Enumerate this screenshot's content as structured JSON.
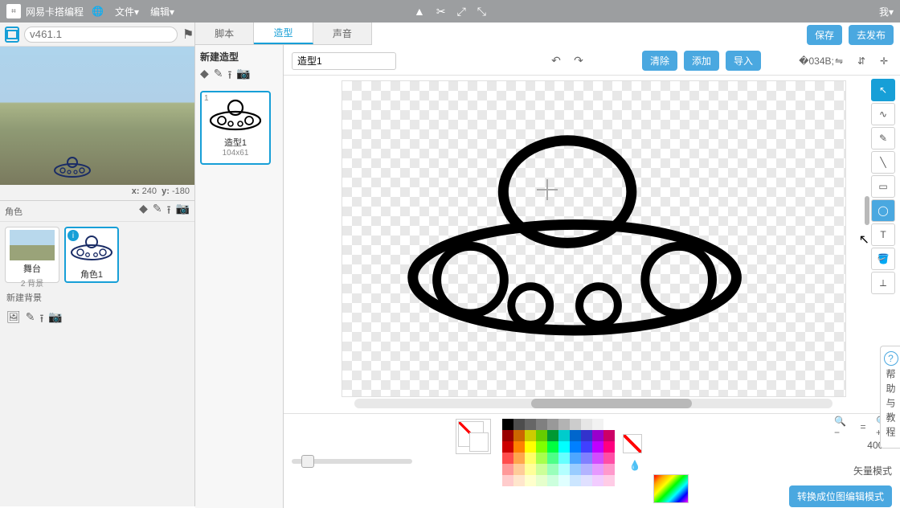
{
  "topbar": {
    "brand": "网易卡搭编程",
    "menus": [
      "文件▾",
      "编辑▾"
    ],
    "right": "我▾"
  },
  "stage": {
    "version": "v461.1",
    "x_label": "x:",
    "x": "240",
    "y_label": "y:",
    "y": "-180",
    "sprites_label": "角色",
    "new_backdrop": "新建背景",
    "stage_thumb": {
      "name": "舞台",
      "sub": "2 背景"
    },
    "sprite_thumb": {
      "name": "角色1"
    }
  },
  "tabs": {
    "script": "脚本",
    "costume": "造型",
    "sound": "声音"
  },
  "mid": {
    "new": "新建造型",
    "costume": {
      "num": "1",
      "name": "造型1",
      "dims": "104x61"
    }
  },
  "editor": {
    "costume_name": "造型1",
    "buttons": {
      "clear": "清除",
      "add": "添加",
      "import": "导入"
    },
    "save": "保存",
    "publish": "去发布",
    "zoom_pct": "400%",
    "mode_label": "矢量模式",
    "mode_button": "转换成位图编辑模式"
  },
  "help_tab": "帮助与教程",
  "palette": [
    "#000000",
    "#4d4d4d",
    "#666666",
    "#808080",
    "#999999",
    "#b3b3b3",
    "#cccccc",
    "#e6e6e6",
    "#f2f2f2",
    "#ffffff",
    "#990000",
    "#cc6600",
    "#cccc00",
    "#66cc00",
    "#009933",
    "#00cccc",
    "#0066cc",
    "#3333cc",
    "#9900cc",
    "#cc0066",
    "#cc0000",
    "#ff8000",
    "#ffff00",
    "#80ff00",
    "#00ff40",
    "#00ffff",
    "#0080ff",
    "#4040ff",
    "#bf00ff",
    "#ff0080",
    "#ff4d4d",
    "#ffa64d",
    "#ffff66",
    "#a6ff4d",
    "#4dff88",
    "#66ffff",
    "#4da6ff",
    "#8080ff",
    "#d24dff",
    "#ff4da6",
    "#ff9999",
    "#ffcc99",
    "#ffff99",
    "#ccff99",
    "#99ffbb",
    "#b3ffff",
    "#99ccff",
    "#b3b3ff",
    "#e699ff",
    "#ff99cc",
    "#ffcccc",
    "#ffe6cc",
    "#ffffcc",
    "#e6ffcc",
    "#ccffdd",
    "#e0ffff",
    "#cce6ff",
    "#e0e0ff",
    "#f2ccff",
    "#ffcce6"
  ]
}
